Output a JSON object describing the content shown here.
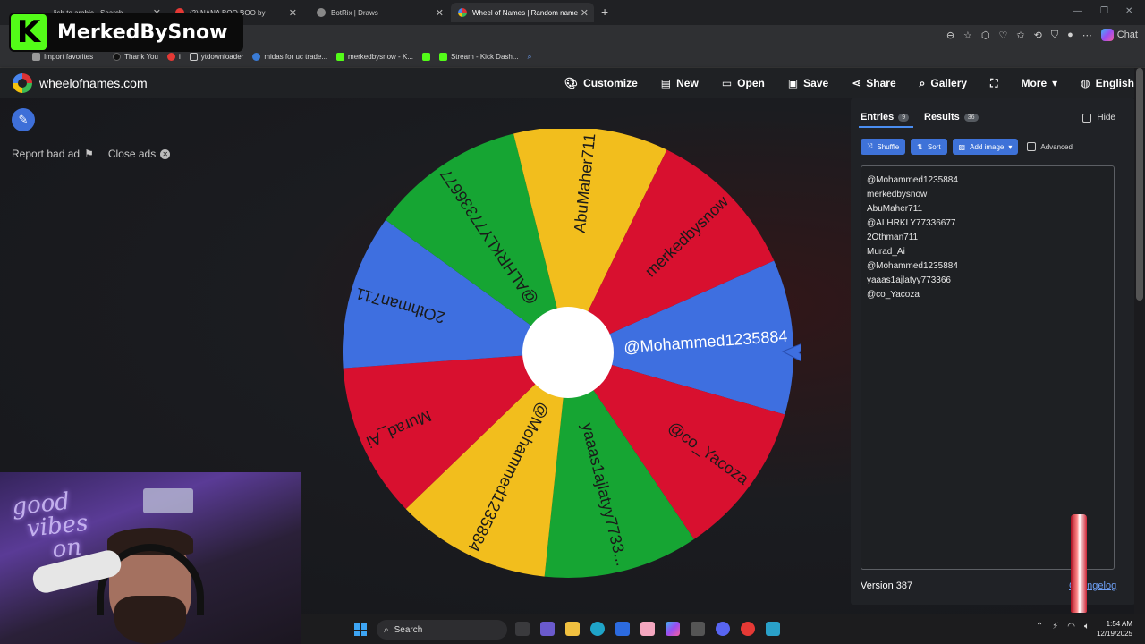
{
  "browser": {
    "tabs": [
      {
        "label": "lish to arabic - Search",
        "active": false
      },
      {
        "label": "(2) NANA BOO BOO by",
        "active": false
      },
      {
        "label": "BotRix | Draws",
        "active": false
      },
      {
        "label": "Wheel of Names | Random name",
        "active": true
      }
    ],
    "chat_label": "Chat",
    "bookmarks": [
      "Import favorites",
      "Thank You",
      "i",
      "ytdownloader",
      "midas for uc trade...",
      "merkedbysnow - K...",
      "Stream - Kick Dash..."
    ]
  },
  "site": {
    "name": "wheelofnames.com",
    "nav": [
      "Customize",
      "New",
      "Open",
      "Save",
      "Share",
      "Gallery",
      "More",
      "English"
    ]
  },
  "ads": {
    "report": "Report bad ad",
    "close": "Close ads"
  },
  "wheel": {
    "segments": [
      {
        "label": "@Mohammed1235884",
        "color": "#3e6fe0"
      },
      {
        "label": "@co_Yacoza",
        "color": "#d8102f"
      },
      {
        "label": "yaaas1ajlatyy7733...",
        "color": "#16a533"
      },
      {
        "label": "@Mohammed1235884",
        "color": "#f2be1d"
      },
      {
        "label": "Murad_Ai",
        "color": "#d8102f"
      },
      {
        "label": "2Othman711",
        "color": "#3e6fe0"
      },
      {
        "label": "@ALHRKLY77336677",
        "color": "#16a533"
      },
      {
        "label": "AbuMaher711",
        "color": "#f2be1d"
      },
      {
        "label": "merkedbysnow",
        "color": "#d8102f"
      }
    ]
  },
  "panel": {
    "entries_tab": "Entries",
    "entries_count": "9",
    "results_tab": "Results",
    "results_count": "36",
    "hide_label": "Hide",
    "shuffle": "Shuffle",
    "sort": "Sort",
    "add_image": "Add image",
    "advanced": "Advanced",
    "entries": [
      "@Mohammed1235884",
      "merkedbysnow",
      "AbuMaher711",
      "@ALHRKLY77336677",
      "2Othman711",
      "Murad_Ai",
      "@Mohammed1235884",
      "yaaas1ajlatyy773366",
      "@co_Yacoza"
    ],
    "version": "Version 387",
    "changelog": "Changelog"
  },
  "overlay": {
    "brand": "MerkedBySnow",
    "brand_letter": "K",
    "neon": [
      "good",
      "vibes",
      "on"
    ]
  },
  "taskbar": {
    "search": "Search",
    "time": "1:54 AM",
    "date": "12/19/2025"
  }
}
